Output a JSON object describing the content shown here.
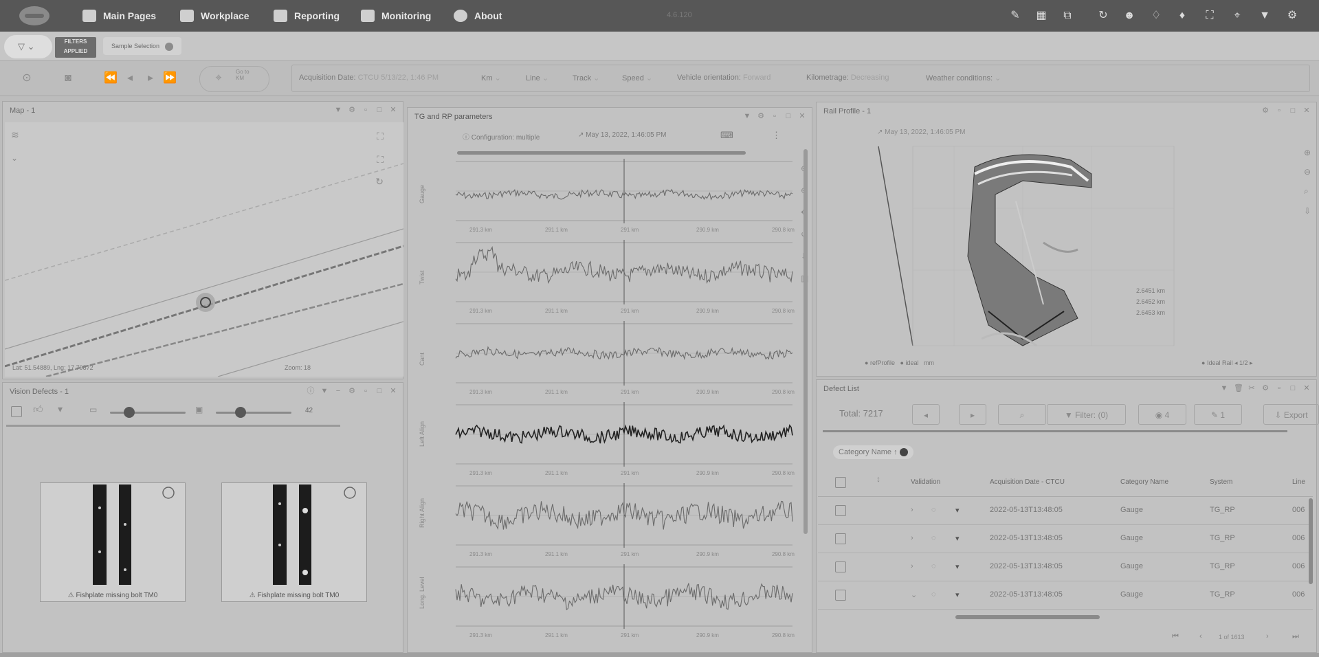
{
  "topnav": {
    "items": [
      {
        "label": "Main Pages",
        "icon": "home-icon"
      },
      {
        "label": "Workplace",
        "icon": "briefcase-icon"
      },
      {
        "label": "Reporting",
        "icon": "document-icon"
      },
      {
        "label": "Monitoring",
        "icon": "monitor-icon"
      },
      {
        "label": "About",
        "icon": "info-icon"
      }
    ],
    "version": "4.6.120",
    "right_icons": [
      "pencil-icon",
      "grid-edit-icon",
      "open-external-icon",
      "refresh-icon",
      "user-icon",
      "bell-outline-icon",
      "bell-icon",
      "fullscreen-icon",
      "add-location-icon",
      "filter-icon",
      "settings-icon"
    ]
  },
  "filterbar": {
    "applied_label": "FILTERS APPLIED",
    "chip_label": "Sample Selection"
  },
  "toolbar": {
    "goto_label": "Go to KM",
    "params": [
      {
        "label": "Acquisition Date:",
        "value": "CTCU 5/13/22, 1:46 PM"
      },
      {
        "label": "Km",
        "value": "⌄"
      },
      {
        "label": "Line",
        "value": "⌄"
      },
      {
        "label": "Track",
        "value": "⌄"
      },
      {
        "label": "Speed",
        "value": "⌄"
      },
      {
        "label": "Vehicle orientation:",
        "value": "Forward"
      },
      {
        "label": "Kilometrage:",
        "value": "Decreasing"
      },
      {
        "label": "Weather conditions:",
        "value": "⌄"
      }
    ]
  },
  "map_panel": {
    "title": "Map - 1",
    "coords": "Lat: 51.54889, Lng: 17.79872",
    "zoom_label": "Zoom: 18"
  },
  "vision_panel": {
    "title": "Vision Defects - 1",
    "slider_value": "42",
    "cards": [
      {
        "caption": "Fishplate missing bolt TM0"
      },
      {
        "caption": "Fishplate missing bolt TM0"
      }
    ]
  },
  "tg_panel": {
    "title": "TG and RP parameters",
    "config_label": "Configuration: multiple",
    "timestamp": "May 13, 2022, 1:46:05 PM",
    "tick_labels": [
      "291.3 km",
      "291.1 km",
      "291 km",
      "290.9 km",
      "290.8 km"
    ],
    "y_labels": [
      "Gauge",
      "Twist",
      "Cant",
      "Left Align",
      "Right Align",
      "Long. Level"
    ]
  },
  "rail_panel": {
    "title": "Rail Profile - 1",
    "timestamp": "May 13, 2022, 1:46:05 PM",
    "legend": [
      "refProfile",
      "ideal",
      "mm"
    ],
    "right_legend": [
      "Ideal Rail"
    ],
    "page": "1/2",
    "axis_labels": [
      "2.6451 km",
      "2.6452 km",
      "2.6453 km"
    ]
  },
  "defect_panel": {
    "title": "Defect List",
    "total": "Total: 7217",
    "filter_label": "Filter: (0)",
    "hidden_count": "4",
    "pin_count": "1",
    "export_label": "Export",
    "group_chip": "Category Name",
    "columns": [
      "Validation",
      "Acquisition Date - CTCU",
      "Category Name",
      "System",
      "Line"
    ],
    "rows": [
      {
        "date": "2022-05-13T13:48:05",
        "category": "Gauge",
        "system": "TG_RP",
        "line": "006"
      },
      {
        "date": "2022-05-13T13:48:05",
        "category": "Gauge",
        "system": "TG_RP",
        "line": "006"
      },
      {
        "date": "2022-05-13T13:48:05",
        "category": "Gauge",
        "system": "TG_RP",
        "line": "006"
      },
      {
        "date": "2022-05-13T13:48:05",
        "category": "Gauge",
        "system": "TG_RP",
        "line": "006"
      }
    ],
    "pagination": "1 of 1613"
  }
}
